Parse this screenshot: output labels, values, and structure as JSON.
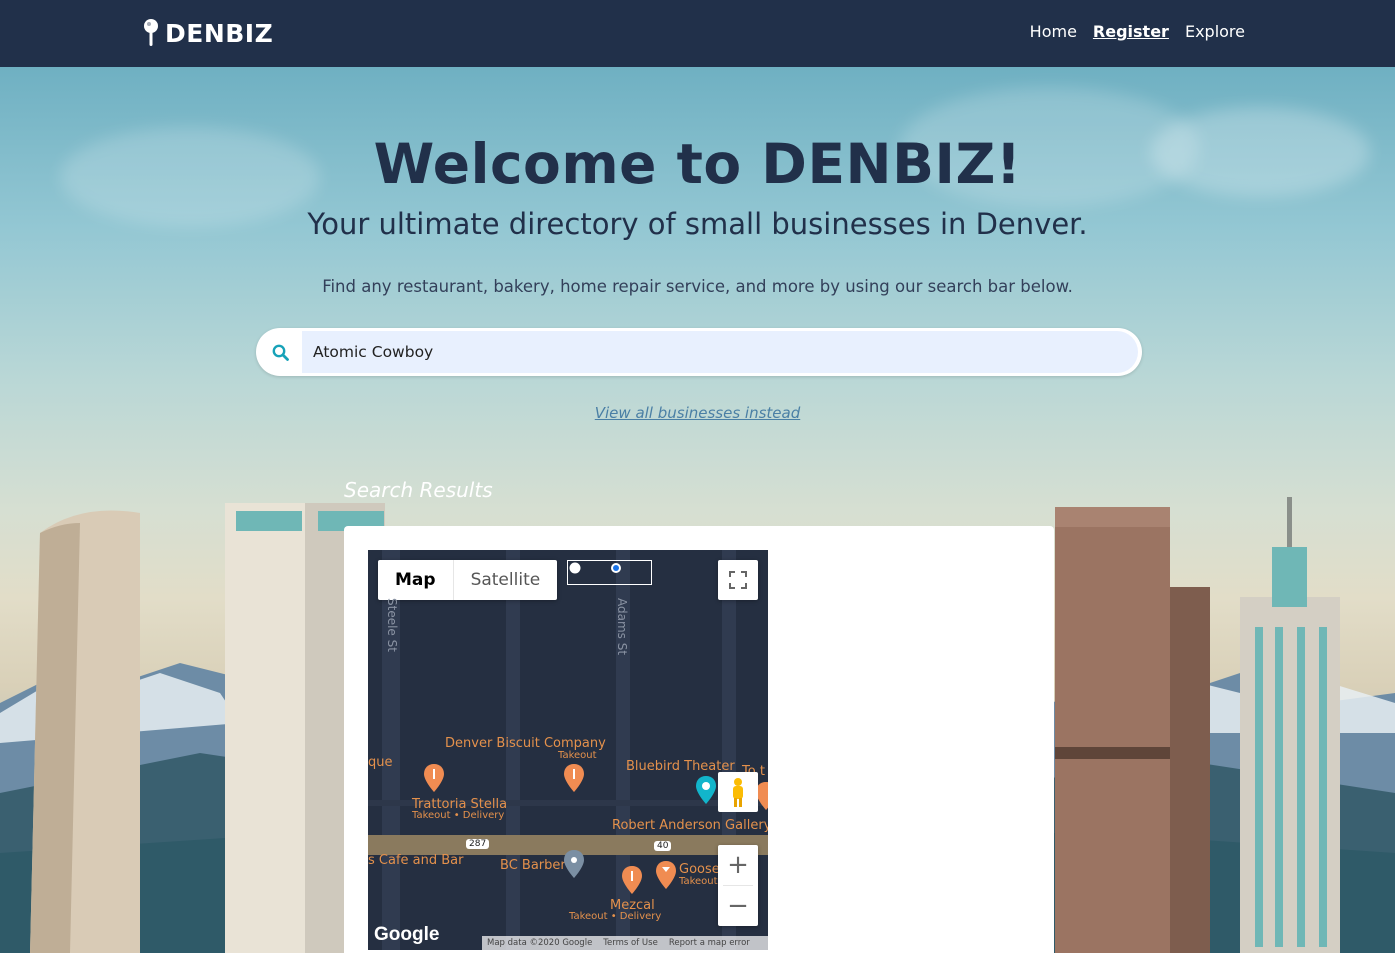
{
  "brand": {
    "name": "DENBIZ"
  },
  "nav": {
    "home": "Home",
    "register": "Register",
    "explore": "Explore"
  },
  "hero": {
    "title": "Welcome to DENBIZ!",
    "subtitle": "Your ultimate directory of small businesses in Denver.",
    "tagline": "Find any restaurant, bakery, home repair service, and more by using our search bar below."
  },
  "search": {
    "value": "Atomic Cowboy",
    "icon": "search-icon"
  },
  "view_all": "View all businesses instead",
  "results": {
    "title": "Search Results"
  },
  "map": {
    "type_map": "Map",
    "type_satellite": "Satellite",
    "streets": {
      "steele": "Steele St",
      "adams": "Adams St"
    },
    "places": {
      "denver_biscuit": "Denver Biscuit Company",
      "denver_biscuit_sub": "Takeout",
      "bluebird": "Bluebird Theater",
      "trattoria": "Trattoria Stella",
      "trattoria_sub": "Takeout • Delivery",
      "robert_anderson": "Robert Anderson Gallery",
      "cafe_bar": "s Cafe and Bar",
      "bc_barber": "BC Barber",
      "goose": "Goose",
      "goose_sub": "Takeout",
      "mezcal": "Mezcal",
      "mezcal_sub": "Takeout • Delivery",
      "que": "que",
      "to": "To t"
    },
    "shields": {
      "us287": "287",
      "us40": "40"
    },
    "zoom_in": "+",
    "zoom_out": "−",
    "google": "Google",
    "attribution": {
      "data": "Map data ©2020 Google",
      "terms": "Terms of Use",
      "report": "Report a map error"
    },
    "colors": {
      "background": "#252f41",
      "label": "#e4914c",
      "road": "#8a7a5e"
    }
  },
  "colors": {
    "navbar": "#21304a",
    "title": "#21304a",
    "link": "#4a7fa5",
    "search_fill": "#e8f0fe"
  }
}
